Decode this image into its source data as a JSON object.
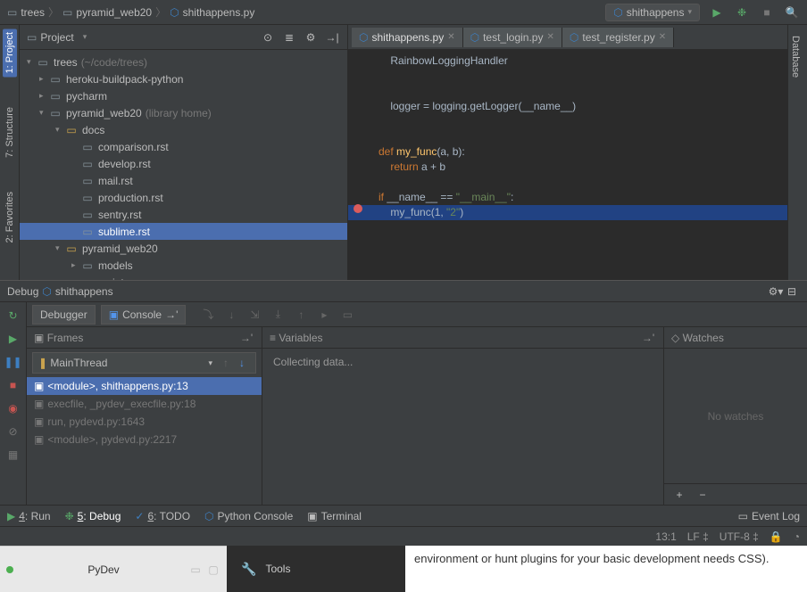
{
  "breadcrumbs": [
    "trees",
    "pyramid_web20",
    "shithappens.py"
  ],
  "run_config": "shithappens",
  "left_tools": {
    "project": "1: Project",
    "structure": "7: Structure"
  },
  "right_tools": {
    "database": "Database"
  },
  "project_panel": {
    "title": "Project",
    "root": {
      "name": "trees",
      "hint": "(~/code/trees)"
    },
    "items": [
      {
        "name": "heroku-buildpack-python",
        "type": "folder",
        "indent": 1
      },
      {
        "name": "pycharm",
        "type": "folder",
        "indent": 1
      },
      {
        "name": "pyramid_web20",
        "hint": "(library home)",
        "type": "folder-open",
        "indent": 1
      },
      {
        "name": "docs",
        "type": "folder-open-y",
        "indent": 2
      },
      {
        "name": "comparison.rst",
        "type": "file",
        "indent": 3
      },
      {
        "name": "develop.rst",
        "type": "file",
        "indent": 3
      },
      {
        "name": "mail.rst",
        "type": "file",
        "indent": 3
      },
      {
        "name": "production.rst",
        "type": "file",
        "indent": 3
      },
      {
        "name": "sentry.rst",
        "type": "file",
        "indent": 3
      },
      {
        "name": "sublime.rst",
        "type": "file",
        "indent": 3,
        "selected": true
      },
      {
        "name": "pyramid_web20",
        "type": "folder-open-y",
        "indent": 2
      },
      {
        "name": "models",
        "type": "folder",
        "indent": 3
      },
      {
        "name": "scripts",
        "type": "folder",
        "indent": 3
      }
    ]
  },
  "editor": {
    "tabs": [
      {
        "label": "shithappens.py",
        "active": true
      },
      {
        "label": "test_login.py",
        "active": false
      },
      {
        "label": "test_register.py",
        "active": false
      }
    ],
    "lines": [
      {
        "raw": "    RainbowLoggingHandler"
      },
      {
        "raw": ""
      },
      {
        "raw": ""
      },
      {
        "raw": "    logger = logging.getLogger(__name__)"
      },
      {
        "raw": ""
      },
      {
        "raw": ""
      },
      {
        "kw1": "def ",
        "fn": "my_func",
        "rest": "(a, b):"
      },
      {
        "kw1": "    return ",
        "rest2": "a + b"
      },
      {
        "raw": ""
      },
      {
        "kw1": "if ",
        "rest3": "__name__ == ",
        "str": "\"__main__\"",
        "colon": ":"
      },
      {
        "hl": true,
        "bp": true,
        "fncall": "    my_func(",
        "num": "1",
        "comma": ", ",
        "str2": "\"2\"",
        "close": ")"
      }
    ]
  },
  "debug": {
    "title": "Debug",
    "session": "shithappens",
    "tabs": {
      "debugger": "Debugger",
      "console": "Console"
    },
    "frames": {
      "title": "Frames",
      "thread": "MainThread",
      "items": [
        {
          "label": "<module>, shithappens.py:13",
          "active": true
        },
        {
          "label": "execfile, _pydev_execfile.py:18"
        },
        {
          "label": "run, pydevd.py:1643"
        },
        {
          "label": "<module>, pydevd.py:2217"
        }
      ]
    },
    "variables": {
      "title": "Variables",
      "status": "Collecting data..."
    },
    "watches": {
      "title": "Watches",
      "empty": "No watches"
    }
  },
  "bottom_tools": {
    "run": "4: Run",
    "debug": "5: Debug",
    "todo": "6: TODO",
    "python_console": "Python Console",
    "terminal": "Terminal",
    "event_log": "Event Log"
  },
  "status": {
    "pos": "13:1",
    "sep": "LF",
    "enc": "UTF-8"
  },
  "below": {
    "pydev": "PyDev",
    "tools_menu": "Tools",
    "article": "environment or hunt plugins for your basic development needs\nCSS)."
  }
}
